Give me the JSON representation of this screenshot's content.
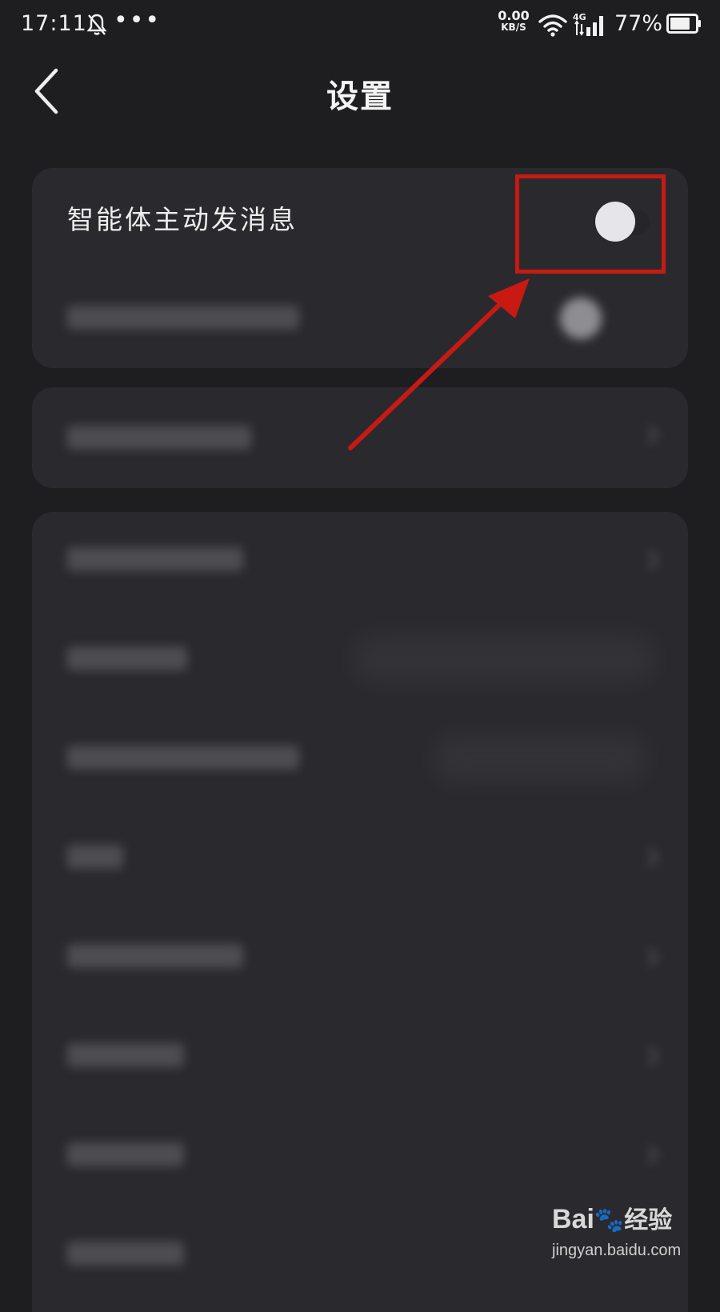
{
  "status_bar": {
    "time": "17:11",
    "dots": "•••",
    "net_speed_value": "0.00",
    "net_speed_unit": "KB/S",
    "network_type": "4G",
    "battery_percent": "77%",
    "battery_level": 0.77
  },
  "header": {
    "title": "设置"
  },
  "settings": {
    "proactive_messages": {
      "label": "智能体主动发消息",
      "toggle_on": false
    }
  },
  "blurred_rows_visible": true,
  "annotation": {
    "color": "#c81912"
  },
  "watermark": {
    "logo_text": "Bai",
    "logo_tail": "经验",
    "url": "jingyan.baidu.com"
  }
}
